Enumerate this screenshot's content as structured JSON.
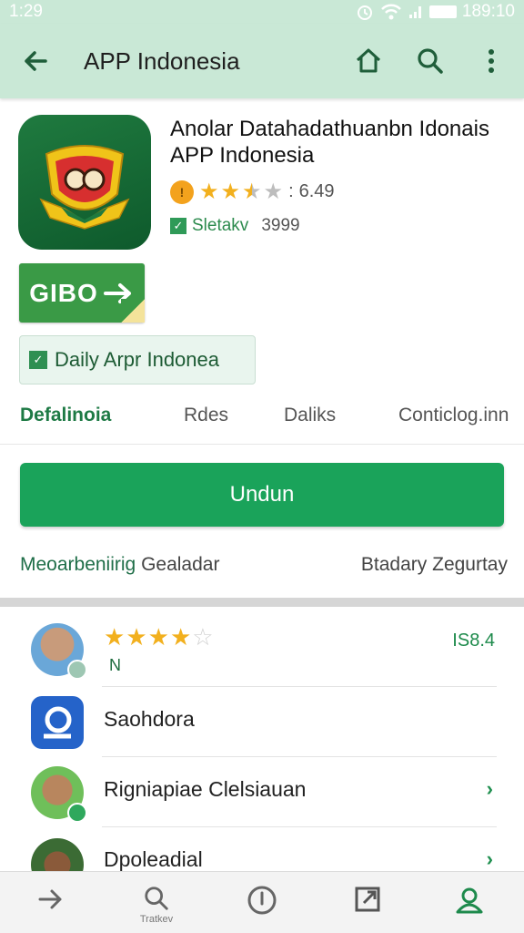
{
  "status_bar": {
    "time": "1:29",
    "right_text": "189:10"
  },
  "app_bar": {
    "title": "APP Indonesia",
    "back_icon": "arrow-left-icon",
    "home_icon": "home-icon",
    "search_icon": "search-icon",
    "more_icon": "more-vert-icon"
  },
  "app": {
    "name_line1": "Anolar Datahadathuanbn Idonais",
    "name_line2": "APP Indonesia",
    "rating_value": "6.49",
    "stars_filled": 2.5,
    "check_label": "Sletakv",
    "check_count": "3999"
  },
  "gibo_button": {
    "label": "GIBO"
  },
  "daily_chip": {
    "label": "Daily Arpr Indonea"
  },
  "tabs": [
    {
      "label": "Defalinoia",
      "active": true
    },
    {
      "label": "Rdes",
      "active": false
    },
    {
      "label": "Daliks",
      "active": false
    },
    {
      "label": "Conticlog.inn",
      "active": false
    }
  ],
  "install_button": {
    "label": "Undun"
  },
  "info_row": {
    "lead": "Meoarbeniirig",
    "left_rest": "Gealadar",
    "right": "Btadary  Zegurtay"
  },
  "review": {
    "stars_filled": 4,
    "stars_total": 5,
    "sublabel": "N",
    "score": "IS8.4"
  },
  "list": [
    {
      "label": "Saohdora"
    },
    {
      "label": "Rigniapiae Clelsiauan"
    },
    {
      "label": "Dpoleadial"
    }
  ],
  "bottom_nav": [
    {
      "icon": "arrow-right-icon",
      "label": ""
    },
    {
      "icon": "search-icon",
      "label": "Tratkev"
    },
    {
      "icon": "info-circle-icon",
      "label": ""
    },
    {
      "icon": "open-box-icon",
      "label": ""
    },
    {
      "icon": "account-icon",
      "label": ""
    }
  ],
  "colors": {
    "accent": "#1aa35a",
    "header": "#c9e8d6",
    "star": "#f2b01e"
  }
}
